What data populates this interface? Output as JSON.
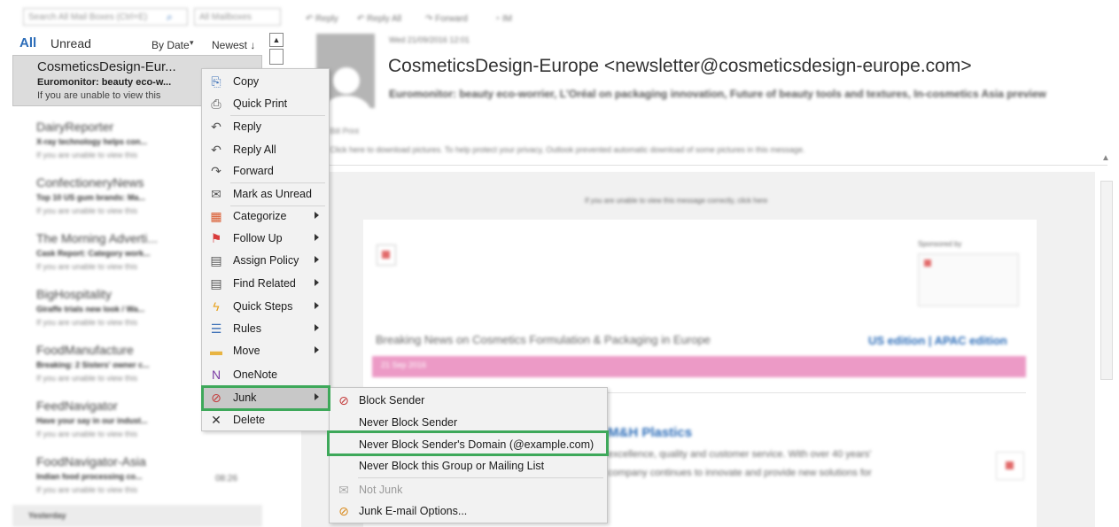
{
  "search": {
    "placeholder": "Search All Mail Boxes (Ctrl+E)",
    "scope": "All Mailboxes"
  },
  "filters": {
    "all": "All",
    "unread": "Unread",
    "sort_by": "By Date",
    "sort_order": "Newest ↓"
  },
  "messages": [
    {
      "sender": "CosmeticsDesign-Eur...",
      "subject": "Euromonitor: beauty eco-w...",
      "preview": "If you are unable to view this",
      "time": ""
    },
    {
      "sender": "DairyReporter",
      "subject": "X-ray technology helps con...",
      "preview": "If you are unable to view this",
      "time": ""
    },
    {
      "sender": "ConfectioneryNews",
      "subject": "Top 10 US gum brands: Ma...",
      "preview": "If you are unable to view this",
      "time": ""
    },
    {
      "sender": "The Morning Adverti...",
      "subject": "Cask Report: Category work...",
      "preview": "If you are unable to view this",
      "time": ""
    },
    {
      "sender": "BigHospitality",
      "subject": "Giraffe trials new look / Wa...",
      "preview": "If you are unable to view this",
      "time": ""
    },
    {
      "sender": "FoodManufacture",
      "subject": "Breaking: 2 Sisters' owner c...",
      "preview": "If you are unable to view this",
      "time": ""
    },
    {
      "sender": "FeedNavigator",
      "subject": "Have your say in our indust...",
      "preview": "If you are unable to view this",
      "time": ""
    },
    {
      "sender": "FoodNavigator-Asia",
      "subject": "Indian food processing co...",
      "preview": "If you are unable to view this",
      "time": "08:26"
    }
  ],
  "group_header": "Yesterday",
  "toolbar": {
    "reply": "Reply",
    "reply_all": "Reply All",
    "forward": "Forward",
    "im": "IM"
  },
  "reading": {
    "date": "Wed 21/09/2016 12:01",
    "from": "CosmeticsDesign-Europe <newsletter@cosmeticsdesign-europe.com>",
    "subject": "Euromonitor: beauty eco-worrier, L'Oréal on packaging innovation, Future of beauty tools and textures, In-cosmetics Asia preview",
    "tag": "Bill Print",
    "info_bar": "Click here to download pictures. To help protect your privacy, Outlook prevented automatic download of some pictures in this message.",
    "notice": "If you are unable to view this message correctly, click here",
    "sponsored": "Sponsored by",
    "breaking": "Breaking News on Cosmetics Formulation & Packaging in Europe",
    "editions": "US edition | APAC edition",
    "date_bar": "21 Sep 2016",
    "headline": "M&H Plastics",
    "text1": "excellence, quality and customer service. With over 40 years'",
    "text2": "company continues to innovate and provide new solutions for"
  },
  "context_menu": [
    {
      "label": "Copy",
      "icon": "copy-icon",
      "glyph": "⎘",
      "color": "#3b6fb6",
      "arrow": false
    },
    {
      "label": "Quick Print",
      "icon": "print-icon",
      "glyph": "⎙",
      "color": "#555555",
      "arrow": false
    },
    {
      "label": "Reply",
      "icon": "reply-icon",
      "glyph": "↶",
      "color": "#555555",
      "arrow": false
    },
    {
      "label": "Reply All",
      "icon": "reply-all-icon",
      "glyph": "↶",
      "color": "#555555",
      "arrow": false
    },
    {
      "label": "Forward",
      "icon": "forward-icon",
      "glyph": "↷",
      "color": "#555555",
      "arrow": false
    },
    {
      "label": "Mark as Unread",
      "icon": "envelope-icon",
      "glyph": "✉",
      "color": "#555555",
      "arrow": false
    },
    {
      "label": "Categorize",
      "icon": "categorize-icon",
      "glyph": "▦",
      "color": "#d9572b",
      "arrow": true
    },
    {
      "label": "Follow Up",
      "icon": "flag-icon",
      "glyph": "⚑",
      "color": "#d83b3b",
      "arrow": true
    },
    {
      "label": "Assign Policy",
      "icon": "policy-icon",
      "glyph": "▤",
      "color": "#555555",
      "arrow": true
    },
    {
      "label": "Find Related",
      "icon": "find-related-icon",
      "glyph": "▤",
      "color": "#555555",
      "arrow": true
    },
    {
      "label": "Quick Steps",
      "icon": "lightning-icon",
      "glyph": "ϟ",
      "color": "#e8a21c",
      "arrow": true
    },
    {
      "label": "Rules",
      "icon": "rules-icon",
      "glyph": "☰",
      "color": "#3b6fb6",
      "arrow": true
    },
    {
      "label": "Move",
      "icon": "folder-icon",
      "glyph": "▬",
      "color": "#e8b442",
      "arrow": true
    },
    {
      "label": "OneNote",
      "icon": "onenote-icon",
      "glyph": "N",
      "color": "#7a3ba4",
      "arrow": false
    },
    {
      "label": "Junk",
      "icon": "junk-icon",
      "glyph": "⊘",
      "color": "#c43c3c",
      "arrow": true
    },
    {
      "label": "Delete",
      "icon": "delete-icon",
      "glyph": "✕",
      "color": "#333333",
      "arrow": false
    }
  ],
  "junk_menu": [
    {
      "label": "Block Sender",
      "icon": "block-sender-icon",
      "glyph": "⊘",
      "color": "#c43c3c",
      "disabled": false
    },
    {
      "label": "Never Block Sender",
      "icon": "",
      "glyph": "",
      "color": "#333333",
      "disabled": false
    },
    {
      "label": "Never Block Sender's Domain (@example.com)",
      "icon": "",
      "glyph": "",
      "color": "#333333",
      "disabled": false
    },
    {
      "label": "Never Block this Group or Mailing List",
      "icon": "",
      "glyph": "",
      "color": "#333333",
      "disabled": false
    },
    {
      "label": "Not Junk",
      "icon": "not-junk-icon",
      "glyph": "✉",
      "color": "#aaaaaa",
      "disabled": true
    },
    {
      "label": "Junk E-mail Options...",
      "icon": "junk-options-icon",
      "glyph": "⊘",
      "color": "#d98b1f",
      "disabled": false
    }
  ],
  "colors": {
    "accent": "#2b6cb8",
    "highlight_border": "#3ea85a",
    "menu_bg": "#f2f2f2"
  }
}
